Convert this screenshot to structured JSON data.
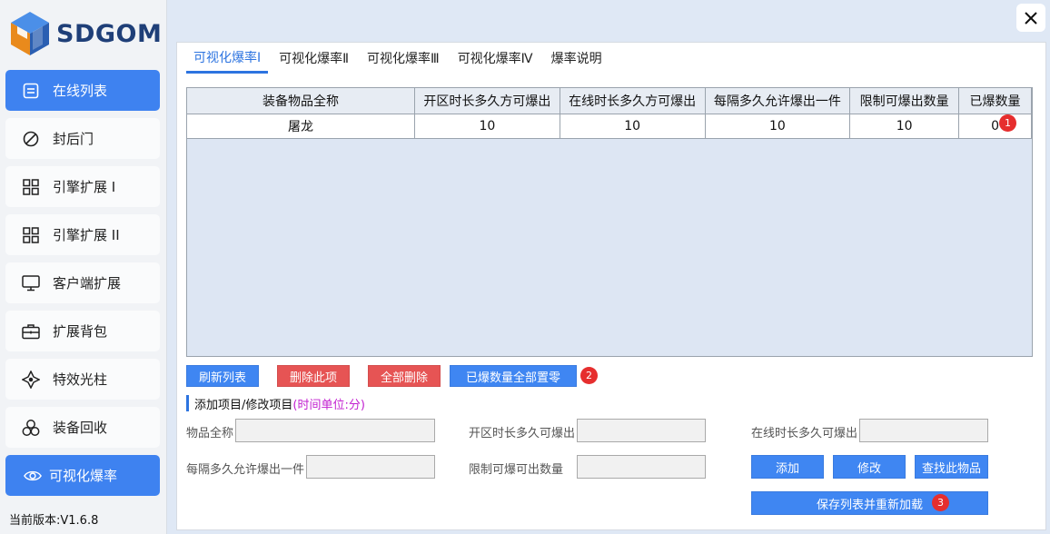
{
  "app": {
    "logo_text": "SDGOM",
    "version": "当前版本:V1.6.8"
  },
  "sidebar": {
    "items": [
      {
        "label": "在线列表",
        "icon": "list-icon",
        "active": true
      },
      {
        "label": "封后门",
        "icon": "block-icon",
        "active": false
      },
      {
        "label": "引擎扩展 I",
        "icon": "grid-icon",
        "active": false
      },
      {
        "label": "引擎扩展 II",
        "icon": "grid-icon",
        "active": false
      },
      {
        "label": "客户端扩展",
        "icon": "monitor-icon",
        "active": false
      },
      {
        "label": "扩展背包",
        "icon": "briefcase-icon",
        "active": false
      },
      {
        "label": "特效光柱",
        "icon": "sparkle-icon",
        "active": false
      },
      {
        "label": "装备回收",
        "icon": "recycle-icon",
        "active": false
      },
      {
        "label": "可视化爆率",
        "icon": "eye-icon",
        "active": true
      }
    ]
  },
  "tabs": [
    {
      "label": "可视化爆率Ⅰ",
      "active": true
    },
    {
      "label": "可视化爆率Ⅱ",
      "active": false
    },
    {
      "label": "可视化爆率Ⅲ",
      "active": false
    },
    {
      "label": "可视化爆率Ⅳ",
      "active": false
    },
    {
      "label": "爆率说明",
      "active": false
    }
  ],
  "table": {
    "columns": [
      "装备物品全称",
      "开区时长多久方可爆出",
      "在线时长多久方可爆出",
      "每隔多久允许爆出一件",
      "限制可爆出数量",
      "已爆数量"
    ],
    "rows": [
      [
        "屠龙",
        "10",
        "10",
        "10",
        "10",
        "0"
      ]
    ]
  },
  "actions": {
    "refresh": "刷新列表",
    "delete_item": "删除此项",
    "delete_all": "全部删除",
    "reset_count": "已爆数量全部置零"
  },
  "badges": {
    "one": "1",
    "two": "2",
    "three": "3"
  },
  "form": {
    "title": "添加项目/修改项目",
    "hint": "(时间单位:分)",
    "name_label": "物品全称",
    "open_label": "开区时长多久可爆出",
    "online_label": "在线时长多久可爆出",
    "interval_label": "每隔多久允许爆出一件",
    "limit_label": "限制可爆可出数量",
    "name_value": "",
    "open_value": "",
    "online_value": "",
    "interval_value": "",
    "limit_value": "",
    "add": "添加",
    "modify": "修改",
    "find": "查找此物品",
    "save_reload": "保存列表并重新加载"
  },
  "colors": {
    "accent": "#3e82f0",
    "danger": "#e65454",
    "badge": "#e62e2e",
    "hint": "#c21fd0"
  }
}
